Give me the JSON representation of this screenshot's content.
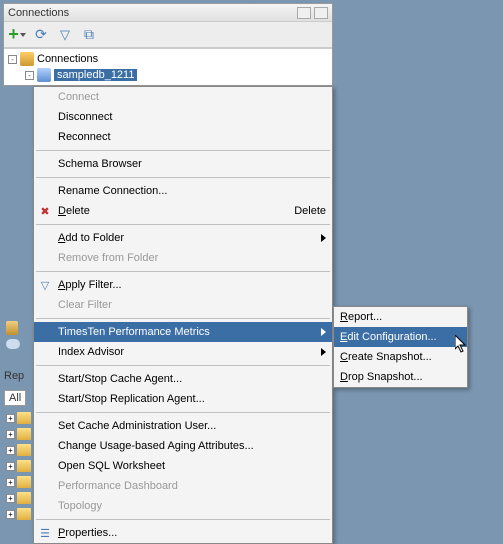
{
  "panel": {
    "title": "Connections"
  },
  "tree": {
    "root": "Connections",
    "selected": "sampledb_1211"
  },
  "context_menu": {
    "items": [
      {
        "label": "Connect",
        "disabled": true
      },
      {
        "label": "Disconnect"
      },
      {
        "label": "Reconnect"
      },
      {
        "sep": true
      },
      {
        "label": "Schema Browser"
      },
      {
        "sep": true
      },
      {
        "label": "Rename Connection..."
      },
      {
        "label": "Delete",
        "underline_first": true,
        "icon": "x",
        "right": "Delete"
      },
      {
        "sep": true
      },
      {
        "label": "Add to Folder",
        "underline_first": true,
        "submenu": true
      },
      {
        "label": "Remove from Folder",
        "disabled": true
      },
      {
        "sep": true
      },
      {
        "label": "Apply Filter...",
        "underline_first": true,
        "icon": "funnel"
      },
      {
        "label": "Clear Filter",
        "disabled": true
      },
      {
        "sep": true
      },
      {
        "label": "TimesTen Performance Metrics",
        "submenu": true,
        "highlight": true
      },
      {
        "label": "Index Advisor",
        "submenu": true
      },
      {
        "sep": true
      },
      {
        "label": "Start/Stop Cache Agent..."
      },
      {
        "label": "Start/Stop Replication Agent..."
      },
      {
        "sep": true
      },
      {
        "label": "Set Cache Administration User..."
      },
      {
        "label": "Change Usage-based Aging Attributes..."
      },
      {
        "label": "Open SQL Worksheet"
      },
      {
        "label": "Performance Dashboard",
        "disabled": true
      },
      {
        "label": "Topology",
        "disabled": true
      },
      {
        "sep": true
      },
      {
        "label": "Properties...",
        "underline_first": true,
        "icon": "props"
      }
    ]
  },
  "submenu": {
    "items": [
      {
        "label": "Report...",
        "underline": "R"
      },
      {
        "label": "Edit Configuration...",
        "underline": "E",
        "highlight": true
      },
      {
        "label": "Create Snapshot...",
        "underline": "C"
      },
      {
        "label": "Drop Snapshot...",
        "underline": "D"
      }
    ]
  },
  "lower": {
    "reports_title": "Rep",
    "tab": "All"
  }
}
